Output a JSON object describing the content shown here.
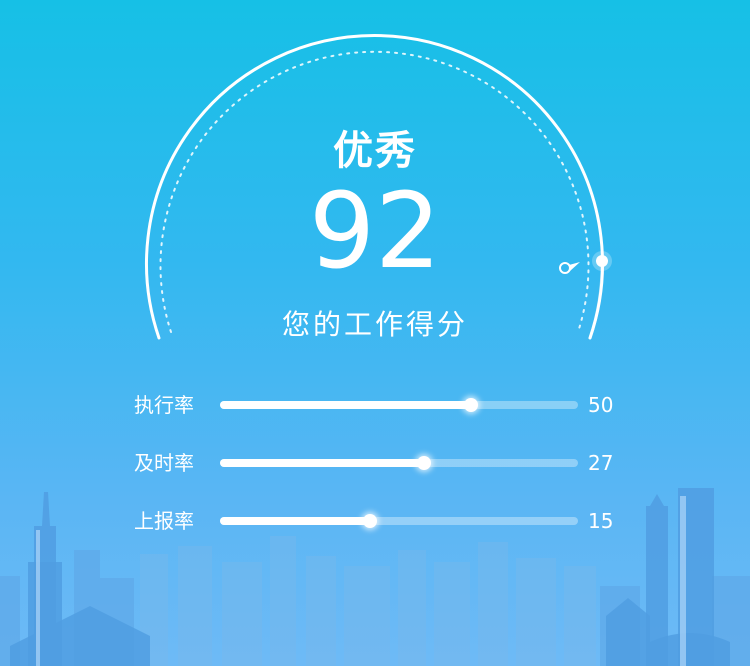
{
  "score_panel": {
    "grade": "优秀",
    "score": "92",
    "caption": "您的工作得分",
    "score_fraction": 0.92
  },
  "metrics": [
    {
      "label": "执行率",
      "value": "50",
      "progress": 0.7
    },
    {
      "label": "及时率",
      "value": "27",
      "progress": 0.57
    },
    {
      "label": "上报率",
      "value": "15",
      "progress": 0.42
    }
  ],
  "colors": {
    "bg_top": "#16c0e6",
    "bg_bottom": "#6ebaf6",
    "foreground": "#ffffff",
    "skyline": "#4aa6e8"
  }
}
